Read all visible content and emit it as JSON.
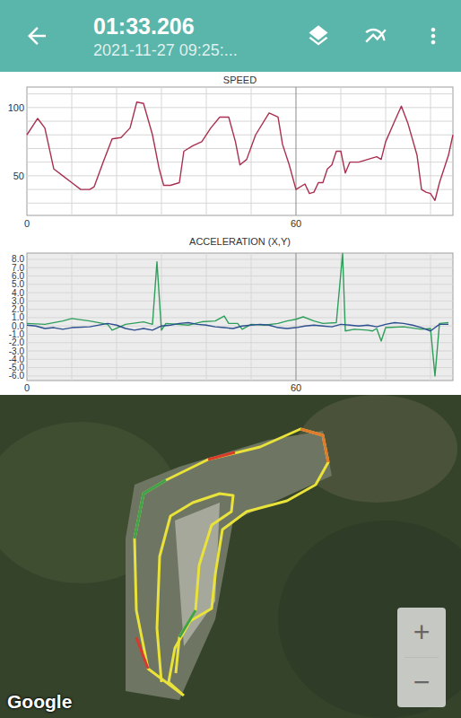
{
  "toolbar": {
    "title": "01:33.206",
    "subtitle": "2021-11-27 09:25:..."
  },
  "charts": [
    {
      "title": "SPEED",
      "y_ticks": [
        "100",
        "50"
      ],
      "x_ticks": [
        "0",
        "60"
      ],
      "series": [
        {
          "color": "#a93050",
          "times": [
            0,
            2.4,
            4,
            6,
            8,
            10,
            12,
            14,
            15,
            17,
            19,
            21,
            23,
            24.5,
            26,
            28,
            29.5,
            30.5,
            32,
            34,
            35,
            37,
            39,
            41,
            43,
            45,
            46.5,
            47.5,
            49,
            51,
            54,
            56,
            57,
            58.5,
            60,
            62,
            63,
            64,
            65,
            66,
            67,
            68,
            69,
            70,
            71,
            72,
            74,
            76,
            78,
            79,
            80,
            82,
            83.5,
            85,
            87,
            88,
            89,
            90,
            91,
            92,
            94,
            95
          ],
          "values": [
            80,
            92,
            85,
            55,
            50,
            45,
            40,
            40,
            42,
            60,
            77,
            78,
            85,
            104,
            103,
            80,
            55,
            43,
            43,
            45,
            68,
            72,
            75,
            85,
            93,
            93,
            75,
            58,
            62,
            80,
            96,
            93,
            73,
            58,
            40,
            44,
            37,
            38,
            45,
            45,
            55,
            58,
            68,
            68,
            52,
            60,
            60,
            62,
            64,
            62,
            75,
            90,
            101,
            88,
            65,
            40,
            38,
            37,
            32,
            45,
            65,
            80
          ]
        }
      ]
    },
    {
      "title": "ACCELERATION (X,Y)",
      "y_ticks": [
        "8.0",
        "7.0",
        "6.0",
        "5.0",
        "4.0",
        "3.0",
        "2.0",
        "1.0",
        "0.0",
        "-1.0",
        "-2.0",
        "-3.0",
        "-4.0",
        "-5.0",
        "-6.0"
      ],
      "x_ticks": [
        "0",
        "60"
      ],
      "series": [
        {
          "color": "#2e9e5b",
          "times": [
            0,
            4,
            8,
            10,
            14,
            18,
            19,
            22,
            26,
            28,
            29,
            30,
            31,
            36,
            39,
            42,
            44,
            45,
            47,
            48,
            50,
            53,
            56,
            58,
            60,
            61.6,
            64,
            66,
            69,
            70.4,
            71,
            73,
            76,
            77,
            78,
            79,
            80,
            84,
            88,
            90,
            91,
            92,
            94
          ],
          "values": [
            0.3,
            0.2,
            0.6,
            0.9,
            0.6,
            0.2,
            -0.5,
            0.2,
            0.5,
            0.2,
            7.7,
            -0.5,
            0.3,
            0.1,
            0.5,
            0.6,
            1.2,
            0.3,
            0.3,
            -0.4,
            0.2,
            0.1,
            0.3,
            0.6,
            0.8,
            1.1,
            0.6,
            0.3,
            0.4,
            8.7,
            -0.6,
            -0.4,
            -0.5,
            -0.6,
            -0.3,
            -1.8,
            -0.2,
            -0.1,
            -0.4,
            -0.3,
            -6.0,
            0.3,
            0.4
          ]
        },
        {
          "color": "#2b4f8f",
          "times": [
            0,
            2,
            4,
            6,
            8,
            10,
            14,
            18,
            20,
            22,
            24,
            26,
            28,
            30,
            32,
            34,
            36,
            38,
            40,
            42,
            44,
            46,
            48,
            50,
            52,
            54,
            56,
            58,
            60,
            62,
            64,
            66,
            68,
            70,
            72,
            74,
            76,
            78,
            80,
            82,
            84,
            86,
            88,
            90,
            92,
            94
          ],
          "values": [
            0.1,
            0,
            -0.3,
            -0.2,
            -0.4,
            -0.2,
            -0.1,
            0.3,
            0.1,
            -0.3,
            -0.5,
            -0.3,
            -0.5,
            0,
            0.1,
            0.3,
            0.4,
            0.2,
            0.1,
            -0.1,
            -0.2,
            -0.3,
            0,
            0.1,
            0.2,
            0.1,
            -0.2,
            -0.3,
            -0.2,
            0,
            0.1,
            0,
            -0.1,
            0.2,
            0.1,
            0,
            0.1,
            -0.1,
            0.2,
            0.4,
            0.3,
            0.1,
            -0.2,
            -0.6,
            0.2,
            0.2
          ]
        }
      ]
    }
  ],
  "map": {
    "attribution": "Google",
    "zoom_buttons": [
      "+",
      "−"
    ]
  }
}
